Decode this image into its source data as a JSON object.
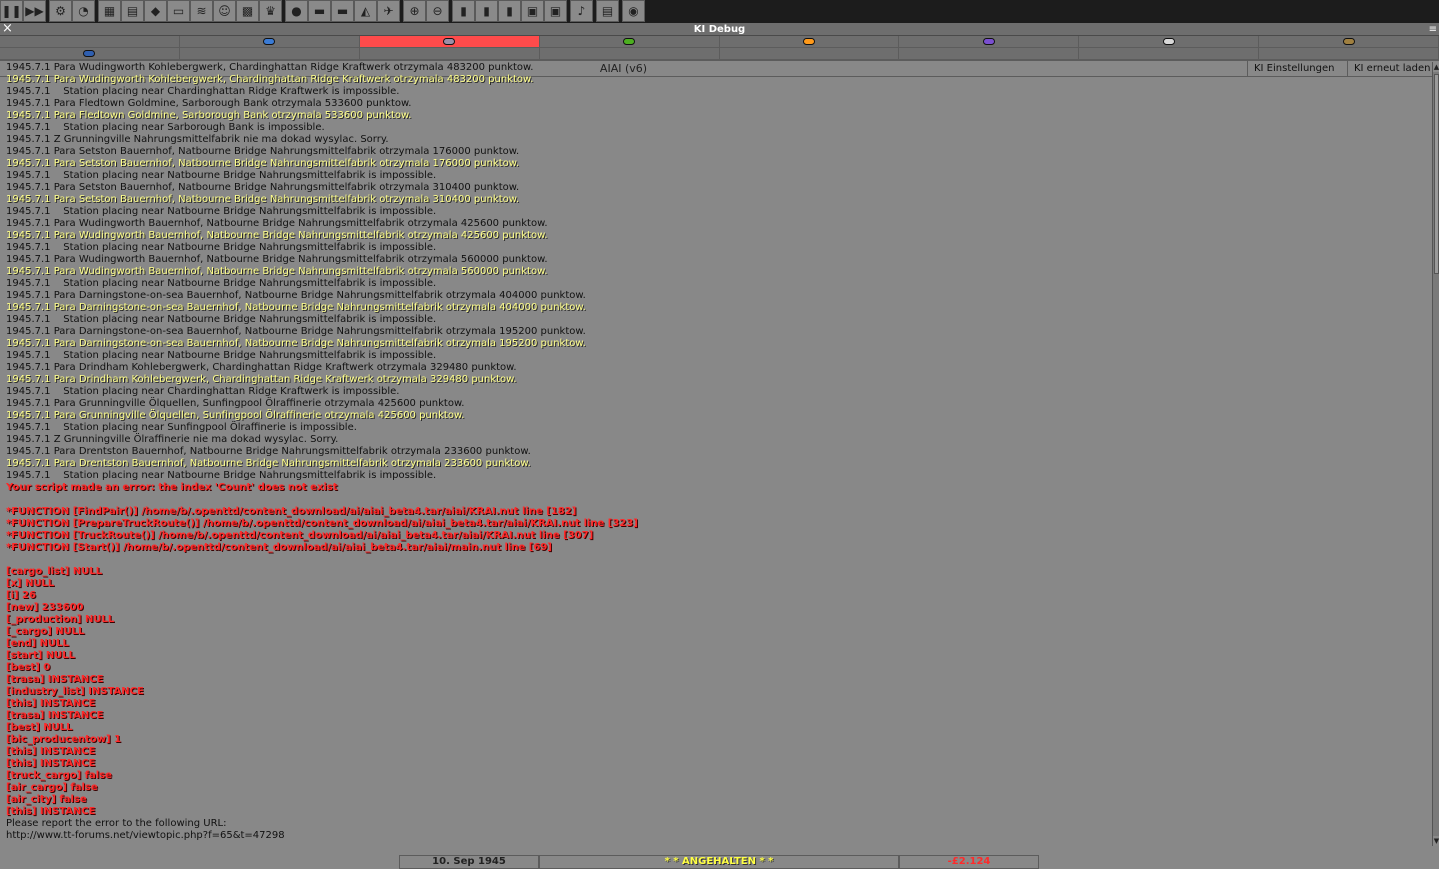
{
  "toolbar": {
    "buttons": [
      {
        "name": "pause-icon",
        "glyph": "❚❚"
      },
      {
        "name": "fast-forward-icon",
        "glyph": "▶▶"
      },
      {
        "name": "settings-icon",
        "glyph": "⚙"
      },
      {
        "name": "save-load-icon",
        "glyph": "◔"
      },
      {
        "name": "map-icon",
        "glyph": "▦"
      },
      {
        "name": "town-directory-icon",
        "glyph": "▤"
      },
      {
        "name": "subsidies-icon",
        "glyph": "◆"
      },
      {
        "name": "station-list-icon",
        "glyph": "▭"
      },
      {
        "name": "finances-icon",
        "glyph": "≋"
      },
      {
        "name": "company-icon",
        "glyph": "☺"
      },
      {
        "name": "graphs-icon",
        "glyph": "▩"
      },
      {
        "name": "league-table-icon",
        "glyph": "♛"
      },
      {
        "name": "industry-icon",
        "glyph": "●"
      },
      {
        "name": "train-list-icon",
        "glyph": "▬"
      },
      {
        "name": "road-vehicle-list-icon",
        "glyph": "▬"
      },
      {
        "name": "ship-list-icon",
        "glyph": "◭"
      },
      {
        "name": "aircraft-list-icon",
        "glyph": "✈"
      },
      {
        "name": "zoom-in-icon",
        "glyph": "⊕"
      },
      {
        "name": "zoom-out-icon",
        "glyph": "⊖"
      },
      {
        "name": "build-railway-icon",
        "glyph": "▮"
      },
      {
        "name": "build-road-icon",
        "glyph": "▮"
      },
      {
        "name": "build-waterways-icon",
        "glyph": "▮"
      },
      {
        "name": "build-airport-icon",
        "glyph": "▣"
      },
      {
        "name": "landscaping-icon",
        "glyph": "▣"
      },
      {
        "name": "music-icon",
        "glyph": "♪"
      },
      {
        "name": "newspaper-icon",
        "glyph": "▤"
      },
      {
        "name": "help-icon",
        "glyph": "◉"
      }
    ]
  },
  "window": {
    "close": "×",
    "title": "KI Debug",
    "sticky": "≡"
  },
  "companies": {
    "row1": [
      {
        "color": "",
        "selected": false
      },
      {
        "color": "#3a7bd5",
        "selected": false
      },
      {
        "color": "#9c8fa8",
        "selected": true
      },
      {
        "color": "#4caf20",
        "selected": false
      },
      {
        "color": "#ff9a1a",
        "selected": false
      },
      {
        "color": "#7a4fd0",
        "selected": false
      },
      {
        "color": "#d8d8d8",
        "selected": false
      },
      {
        "color": "#a08040",
        "selected": false
      }
    ],
    "row2": [
      {
        "color": "#2f5fb0",
        "selected": false
      },
      {
        "color": "",
        "selected": false
      },
      {
        "color": "",
        "selected": false
      },
      {
        "color": "",
        "selected": false
      },
      {
        "color": "",
        "selected": false
      },
      {
        "color": "",
        "selected": false
      },
      {
        "color": "",
        "selected": false
      },
      {
        "color": "",
        "selected": false
      }
    ]
  },
  "ai": {
    "name": "AIAI (v6)",
    "settings_button": "KI Einstellungen",
    "reload_button": "KI erneut laden"
  },
  "log": [
    {
      "t": "normal",
      "text": "1945.7.1 Para Wudingworth Kohlebergwerk, Chardinghattan Ridge Kraftwerk otrzymala 483200 punktow."
    },
    {
      "t": "yellow",
      "text": "1945.7.1 Para Wudingworth Kohlebergwerk, Chardinghattan Ridge Kraftwerk otrzymala 483200 punktow."
    },
    {
      "t": "normal",
      "text": "1945.7.1    Station placing near Chardinghattan Ridge Kraftwerk is impossible."
    },
    {
      "t": "normal",
      "text": "1945.7.1 Para Fledtown Goldmine, Sarborough Bank otrzymala 533600 punktow."
    },
    {
      "t": "yellow",
      "text": "1945.7.1 Para Fledtown Goldmine, Sarborough Bank otrzymala 533600 punktow."
    },
    {
      "t": "normal",
      "text": "1945.7.1    Station placing near Sarborough Bank is impossible."
    },
    {
      "t": "normal",
      "text": "1945.7.1 Z Grunningville Nahrungsmittelfabrik nie ma dokad wysylac. Sorry."
    },
    {
      "t": "normal",
      "text": "1945.7.1 Para Setston Bauernhof, Natbourne Bridge Nahrungsmittelfabrik otrzymala 176000 punktow."
    },
    {
      "t": "yellow",
      "text": "1945.7.1 Para Setston Bauernhof, Natbourne Bridge Nahrungsmittelfabrik otrzymala 176000 punktow."
    },
    {
      "t": "normal",
      "text": "1945.7.1    Station placing near Natbourne Bridge Nahrungsmittelfabrik is impossible."
    },
    {
      "t": "normal",
      "text": "1945.7.1 Para Setston Bauernhof, Natbourne Bridge Nahrungsmittelfabrik otrzymala 310400 punktow."
    },
    {
      "t": "yellow",
      "text": "1945.7.1 Para Setston Bauernhof, Natbourne Bridge Nahrungsmittelfabrik otrzymala 310400 punktow."
    },
    {
      "t": "normal",
      "text": "1945.7.1    Station placing near Natbourne Bridge Nahrungsmittelfabrik is impossible."
    },
    {
      "t": "normal",
      "text": "1945.7.1 Para Wudingworth Bauernhof, Natbourne Bridge Nahrungsmittelfabrik otrzymala 425600 punktow."
    },
    {
      "t": "yellow",
      "text": "1945.7.1 Para Wudingworth Bauernhof, Natbourne Bridge Nahrungsmittelfabrik otrzymala 425600 punktow."
    },
    {
      "t": "normal",
      "text": "1945.7.1    Station placing near Natbourne Bridge Nahrungsmittelfabrik is impossible."
    },
    {
      "t": "normal",
      "text": "1945.7.1 Para Wudingworth Bauernhof, Natbourne Bridge Nahrungsmittelfabrik otrzymala 560000 punktow."
    },
    {
      "t": "yellow",
      "text": "1945.7.1 Para Wudingworth Bauernhof, Natbourne Bridge Nahrungsmittelfabrik otrzymala 560000 punktow."
    },
    {
      "t": "normal",
      "text": "1945.7.1    Station placing near Natbourne Bridge Nahrungsmittelfabrik is impossible."
    },
    {
      "t": "normal",
      "text": "1945.7.1 Para Darningstone-on-sea Bauernhof, Natbourne Bridge Nahrungsmittelfabrik otrzymala 404000 punktow."
    },
    {
      "t": "yellow",
      "text": "1945.7.1 Para Darningstone-on-sea Bauernhof, Natbourne Bridge Nahrungsmittelfabrik otrzymala 404000 punktow."
    },
    {
      "t": "normal",
      "text": "1945.7.1    Station placing near Natbourne Bridge Nahrungsmittelfabrik is impossible."
    },
    {
      "t": "normal",
      "text": "1945.7.1 Para Darningstone-on-sea Bauernhof, Natbourne Bridge Nahrungsmittelfabrik otrzymala 195200 punktow."
    },
    {
      "t": "yellow",
      "text": "1945.7.1 Para Darningstone-on-sea Bauernhof, Natbourne Bridge Nahrungsmittelfabrik otrzymala 195200 punktow."
    },
    {
      "t": "normal",
      "text": "1945.7.1    Station placing near Natbourne Bridge Nahrungsmittelfabrik is impossible."
    },
    {
      "t": "normal",
      "text": "1945.7.1 Para Drindham Kohlebergwerk, Chardinghattan Ridge Kraftwerk otrzymala 329480 punktow."
    },
    {
      "t": "yellow",
      "text": "1945.7.1 Para Drindham Kohlebergwerk, Chardinghattan Ridge Kraftwerk otrzymala 329480 punktow."
    },
    {
      "t": "normal",
      "text": "1945.7.1    Station placing near Chardinghattan Ridge Kraftwerk is impossible."
    },
    {
      "t": "normal",
      "text": "1945.7.1 Para Grunningville Ölquellen, Sunfingpool Ölraffinerie otrzymala 425600 punktow."
    },
    {
      "t": "yellow",
      "text": "1945.7.1 Para Grunningville Ölquellen, Sunfingpool Ölraffinerie otrzymala 425600 punktow."
    },
    {
      "t": "normal",
      "text": "1945.7.1    Station placing near Sunfingpool Ölraffinerie is impossible."
    },
    {
      "t": "normal",
      "text": "1945.7.1 Z Grunningville Ölraffinerie nie ma dokad wysylac. Sorry."
    },
    {
      "t": "normal",
      "text": "1945.7.1 Para Drentston Bauernhof, Natbourne Bridge Nahrungsmittelfabrik otrzymala 233600 punktow."
    },
    {
      "t": "yellow",
      "text": "1945.7.1 Para Drentston Bauernhof, Natbourne Bridge Nahrungsmittelfabrik otrzymala 233600 punktow."
    },
    {
      "t": "normal",
      "text": "1945.7.1    Station placing near Natbourne Bridge Nahrungsmittelfabrik is impossible."
    },
    {
      "t": "error",
      "text": "Your script made an error: the index 'Count' does not exist"
    },
    {
      "t": "blank",
      "text": ""
    },
    {
      "t": "error",
      "text": "*FUNCTION [FindPair()] /home/b/.openttd/content_download/ai/aiai_beta4.tar/aiai/KRAI.nut line [182]"
    },
    {
      "t": "error",
      "text": "*FUNCTION [PrepareTruckRoute()] /home/b/.openttd/content_download/ai/aiai_beta4.tar/aiai/KRAI.nut line [323]"
    },
    {
      "t": "error",
      "text": "*FUNCTION [TruckRoute()] /home/b/.openttd/content_download/ai/aiai_beta4.tar/aiai/KRAI.nut line [307]"
    },
    {
      "t": "error",
      "text": "*FUNCTION [Start()] /home/b/.openttd/content_download/ai/aiai_beta4.tar/aiai/main.nut line [69]"
    },
    {
      "t": "blank",
      "text": ""
    },
    {
      "t": "error",
      "text": "[cargo_list] NULL"
    },
    {
      "t": "error",
      "text": "[x] NULL"
    },
    {
      "t": "error",
      "text": "[i] 26"
    },
    {
      "t": "error",
      "text": "[new] 233600"
    },
    {
      "t": "error",
      "text": "[_production] NULL"
    },
    {
      "t": "error",
      "text": "[_cargo] NULL"
    },
    {
      "t": "error",
      "text": "[end] NULL"
    },
    {
      "t": "error",
      "text": "[start] NULL"
    },
    {
      "t": "error",
      "text": "[best] 0"
    },
    {
      "t": "error",
      "text": "[trasa] INSTANCE"
    },
    {
      "t": "error",
      "text": "[industry_list] INSTANCE"
    },
    {
      "t": "error",
      "text": "[this] INSTANCE"
    },
    {
      "t": "error",
      "text": "[trasa] INSTANCE"
    },
    {
      "t": "error",
      "text": "[best] NULL"
    },
    {
      "t": "error",
      "text": "[bic_producentow] 1"
    },
    {
      "t": "error",
      "text": "[this] INSTANCE"
    },
    {
      "t": "error",
      "text": "[this] INSTANCE"
    },
    {
      "t": "error",
      "text": "[truck_cargo] false"
    },
    {
      "t": "error",
      "text": "[air_cargo] false"
    },
    {
      "t": "error",
      "text": "[air_city] false"
    },
    {
      "t": "error",
      "text": "[this] INSTANCE"
    },
    {
      "t": "normal",
      "text": "Please report the error to the following URL:"
    },
    {
      "t": "normal",
      "text": "http://www.tt-forums.net/viewtopic.php?f=65&t=47298"
    }
  ],
  "statusbar": {
    "date": "10. Sep 1945",
    "message": "* * ANGEHALTEN * *",
    "money": "-£2.124"
  }
}
